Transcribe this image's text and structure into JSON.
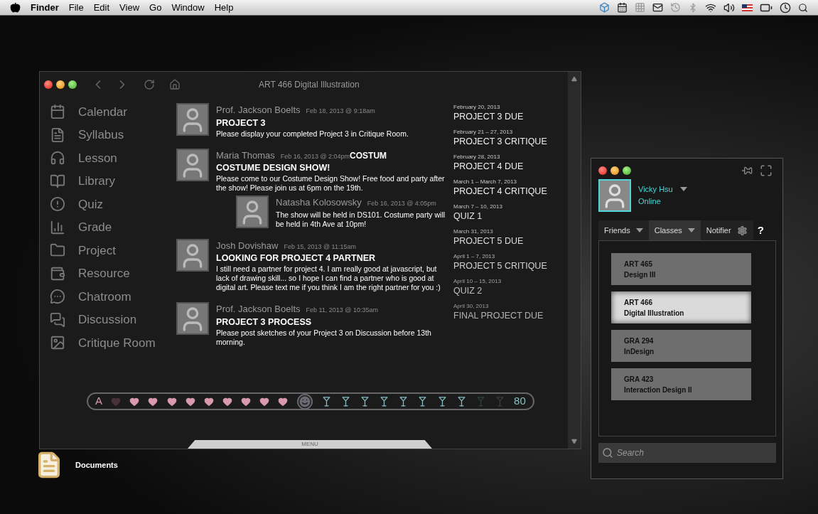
{
  "menu_bar": {
    "app": "Finder",
    "items": [
      "File",
      "Edit",
      "View",
      "Go",
      "Window",
      "Help"
    ]
  },
  "desktop_icons": [
    {
      "label": "Documents"
    }
  ],
  "main_window": {
    "title": "ART 466 Digital Illustration",
    "sidebar": {
      "items": [
        {
          "label": "Calendar",
          "selected": false
        },
        {
          "label": "Syllabus",
          "selected": false
        },
        {
          "label": "Lesson",
          "selected": false
        },
        {
          "label": "Library",
          "selected": false
        },
        {
          "label": "Quiz",
          "selected": false
        },
        {
          "label": "Grade",
          "selected": false
        },
        {
          "label": "Project",
          "selected": false
        },
        {
          "label": "Resource",
          "selected": false
        },
        {
          "label": "Chatroom",
          "selected": false
        },
        {
          "label": "Discussion",
          "selected": false
        },
        {
          "label": "Critique Room",
          "selected": false
        }
      ]
    },
    "posts": [
      {
        "author": "Prof. Jackson Boelts",
        "time": "Feb 18, 2013 @ 9:18am",
        "title": "PROJECT 3",
        "body": "Please display your completed Project 3 in Critique Room."
      },
      {
        "author": "Maria Thomas",
        "time": "Feb 16, 2013 @ 2:04pm",
        "overlap_text": "COSTUM",
        "title": "COSTUME DESIGN SHOW!",
        "body": "Please come to our Costume Design Show! Free food and party after the show! Please join us at 6pm on the 19th.",
        "children": [
          {
            "author": "Natasha Kolosowsky",
            "time": "Feb 16, 2013 @ 4:05pm",
            "body": "The show will be held in DS101. Costume party will be held in 4th Ave at 10pm!"
          }
        ]
      },
      {
        "author": "Josh Dovishaw",
        "time": "Feb 15, 2013 @ 11:15am",
        "title": "LOOKING FOR PROJECT 4 PARTNER",
        "body": "I still need a partner for project 4. I am really good at javascript, but lack of drawing skill... so I hope I can find a partner who is good at digital art. Please text me if you think I am the right partner for you :)"
      },
      {
        "author": "Prof. Jackson Boelts",
        "time": "Feb 11, 2013 @ 10:35am",
        "title": "PROJECT 3 PROCESS",
        "body": "Please post sketches of your Project 3 on Discussion before 13th morning."
      }
    ],
    "schedule": [
      {
        "date": "February 20, 2013",
        "event": "PROJECT 3 DUE"
      },
      {
        "date": "February 21 – 27, 2013",
        "event": "PROJECT 3 CRITIQUE"
      },
      {
        "date": "February 28, 2013",
        "event": "PROJECT 4 DUE"
      },
      {
        "date": "March 1 – March 7, 2013",
        "event": "PROJECT 4 CRITIQUE"
      },
      {
        "date": "March 7 – 10, 2013",
        "event": "QUIZ 1"
      },
      {
        "date": "March 31, 2013",
        "event": "PROJECT 5 DUE"
      },
      {
        "date": "April 1 – 7, 2013",
        "event": "PROJECT 5 CRITIQUE"
      },
      {
        "date": "April 10 – 15, 2013",
        "event": "QUIZ 2"
      },
      {
        "date": "April 30, 2013",
        "event": "FINAL PROJECT DUE"
      }
    ],
    "status_bar": {
      "grade": "A",
      "hearts": [
        {
          "filled": false
        },
        {
          "filled": true
        },
        {
          "filled": true
        },
        {
          "filled": true
        },
        {
          "filled": true
        },
        {
          "filled": true
        },
        {
          "filled": true
        },
        {
          "filled": true
        },
        {
          "filled": true
        },
        {
          "filled": true
        }
      ],
      "drinks": [
        {
          "filled": true
        },
        {
          "filled": true
        },
        {
          "filled": true
        },
        {
          "filled": true
        },
        {
          "filled": true
        },
        {
          "filled": true
        },
        {
          "filled": true
        },
        {
          "filled": true
        },
        {
          "filled": false
        },
        {
          "filled": false
        }
      ],
      "score": "80"
    },
    "menu_tab": "MENU"
  },
  "side_panel": {
    "user": {
      "name": "Vicky Hsu",
      "status": "Online"
    },
    "tabs": [
      {
        "label": "Friends",
        "kind": "dropdown",
        "selected": false
      },
      {
        "label": "Classes",
        "kind": "dropdown",
        "selected": true
      },
      {
        "label": "Notifier",
        "kind": "settings",
        "selected": false
      }
    ],
    "help": "?",
    "classes": [
      {
        "code": "ART 465",
        "name": "Design III",
        "selected": false
      },
      {
        "code": "ART 466",
        "name": "Digital Illustration",
        "selected": true
      },
      {
        "code": "GRA 294",
        "name": "InDesign",
        "selected": false
      },
      {
        "code": "GRA 423",
        "name": "Interaction Design II",
        "selected": false
      }
    ],
    "search": {
      "placeholder": "Search"
    }
  }
}
